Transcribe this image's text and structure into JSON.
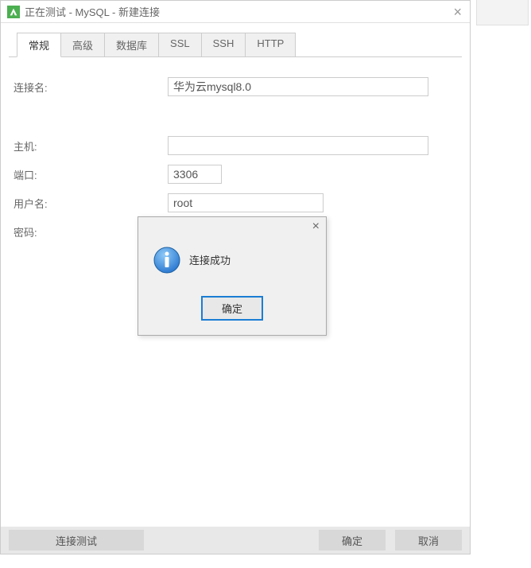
{
  "titlebar": {
    "title": "正在测试 - MySQL - 新建连接"
  },
  "tabs": [
    {
      "label": "常规",
      "active": true
    },
    {
      "label": "高级",
      "active": false
    },
    {
      "label": "数据库",
      "active": false
    },
    {
      "label": "SSL",
      "active": false
    },
    {
      "label": "SSH",
      "active": false
    },
    {
      "label": "HTTP",
      "active": false
    }
  ],
  "form": {
    "connection_name": {
      "label": "连接名:",
      "value": "华为云mysql8.0"
    },
    "host": {
      "label": "主机:",
      "value": ""
    },
    "port": {
      "label": "端口:",
      "value": "3306"
    },
    "username": {
      "label": "用户名:",
      "value": "root"
    },
    "password": {
      "label": "密码:",
      "value": "••••••"
    }
  },
  "footer": {
    "test_connection": "连接测试",
    "ok": "确定",
    "cancel": "取消"
  },
  "modal": {
    "message": "连接成功",
    "ok": "确定"
  }
}
